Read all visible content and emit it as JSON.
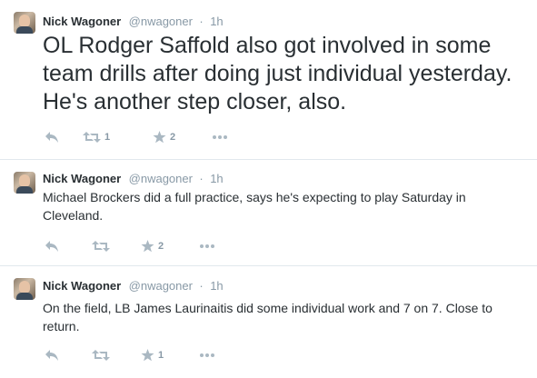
{
  "tweets": [
    {
      "name": "Nick Wagoner",
      "handle": "@nwagoner",
      "separator": "·",
      "time": "1h",
      "text": "OL Rodger Saffold also got involved in some team drills after doing just individual yesterday. He's another step closer, also.",
      "retweets": "1",
      "favorites": "2"
    },
    {
      "name": "Nick Wagoner",
      "handle": "@nwagoner",
      "separator": "·",
      "time": "1h",
      "text": "Michael Brockers did a full practice, says he's expecting to play Saturday in Cleveland.",
      "retweets": "",
      "favorites": "2"
    },
    {
      "name": "Nick Wagoner",
      "handle": "@nwagoner",
      "separator": "·",
      "time": "1h",
      "text": "On the field, LB James Laurinaitis did some individual work and 7 on 7. Close to return.",
      "retweets": "",
      "favorites": "1"
    }
  ],
  "icons": {
    "reply": "reply-icon",
    "retweet": "retweet-icon",
    "favorite": "star-icon",
    "more": "more-icon"
  },
  "colors": {
    "text": "#292f33",
    "secondary": "#8899a6",
    "icon": "#aab8c2",
    "divider": "#e1e8ed"
  }
}
